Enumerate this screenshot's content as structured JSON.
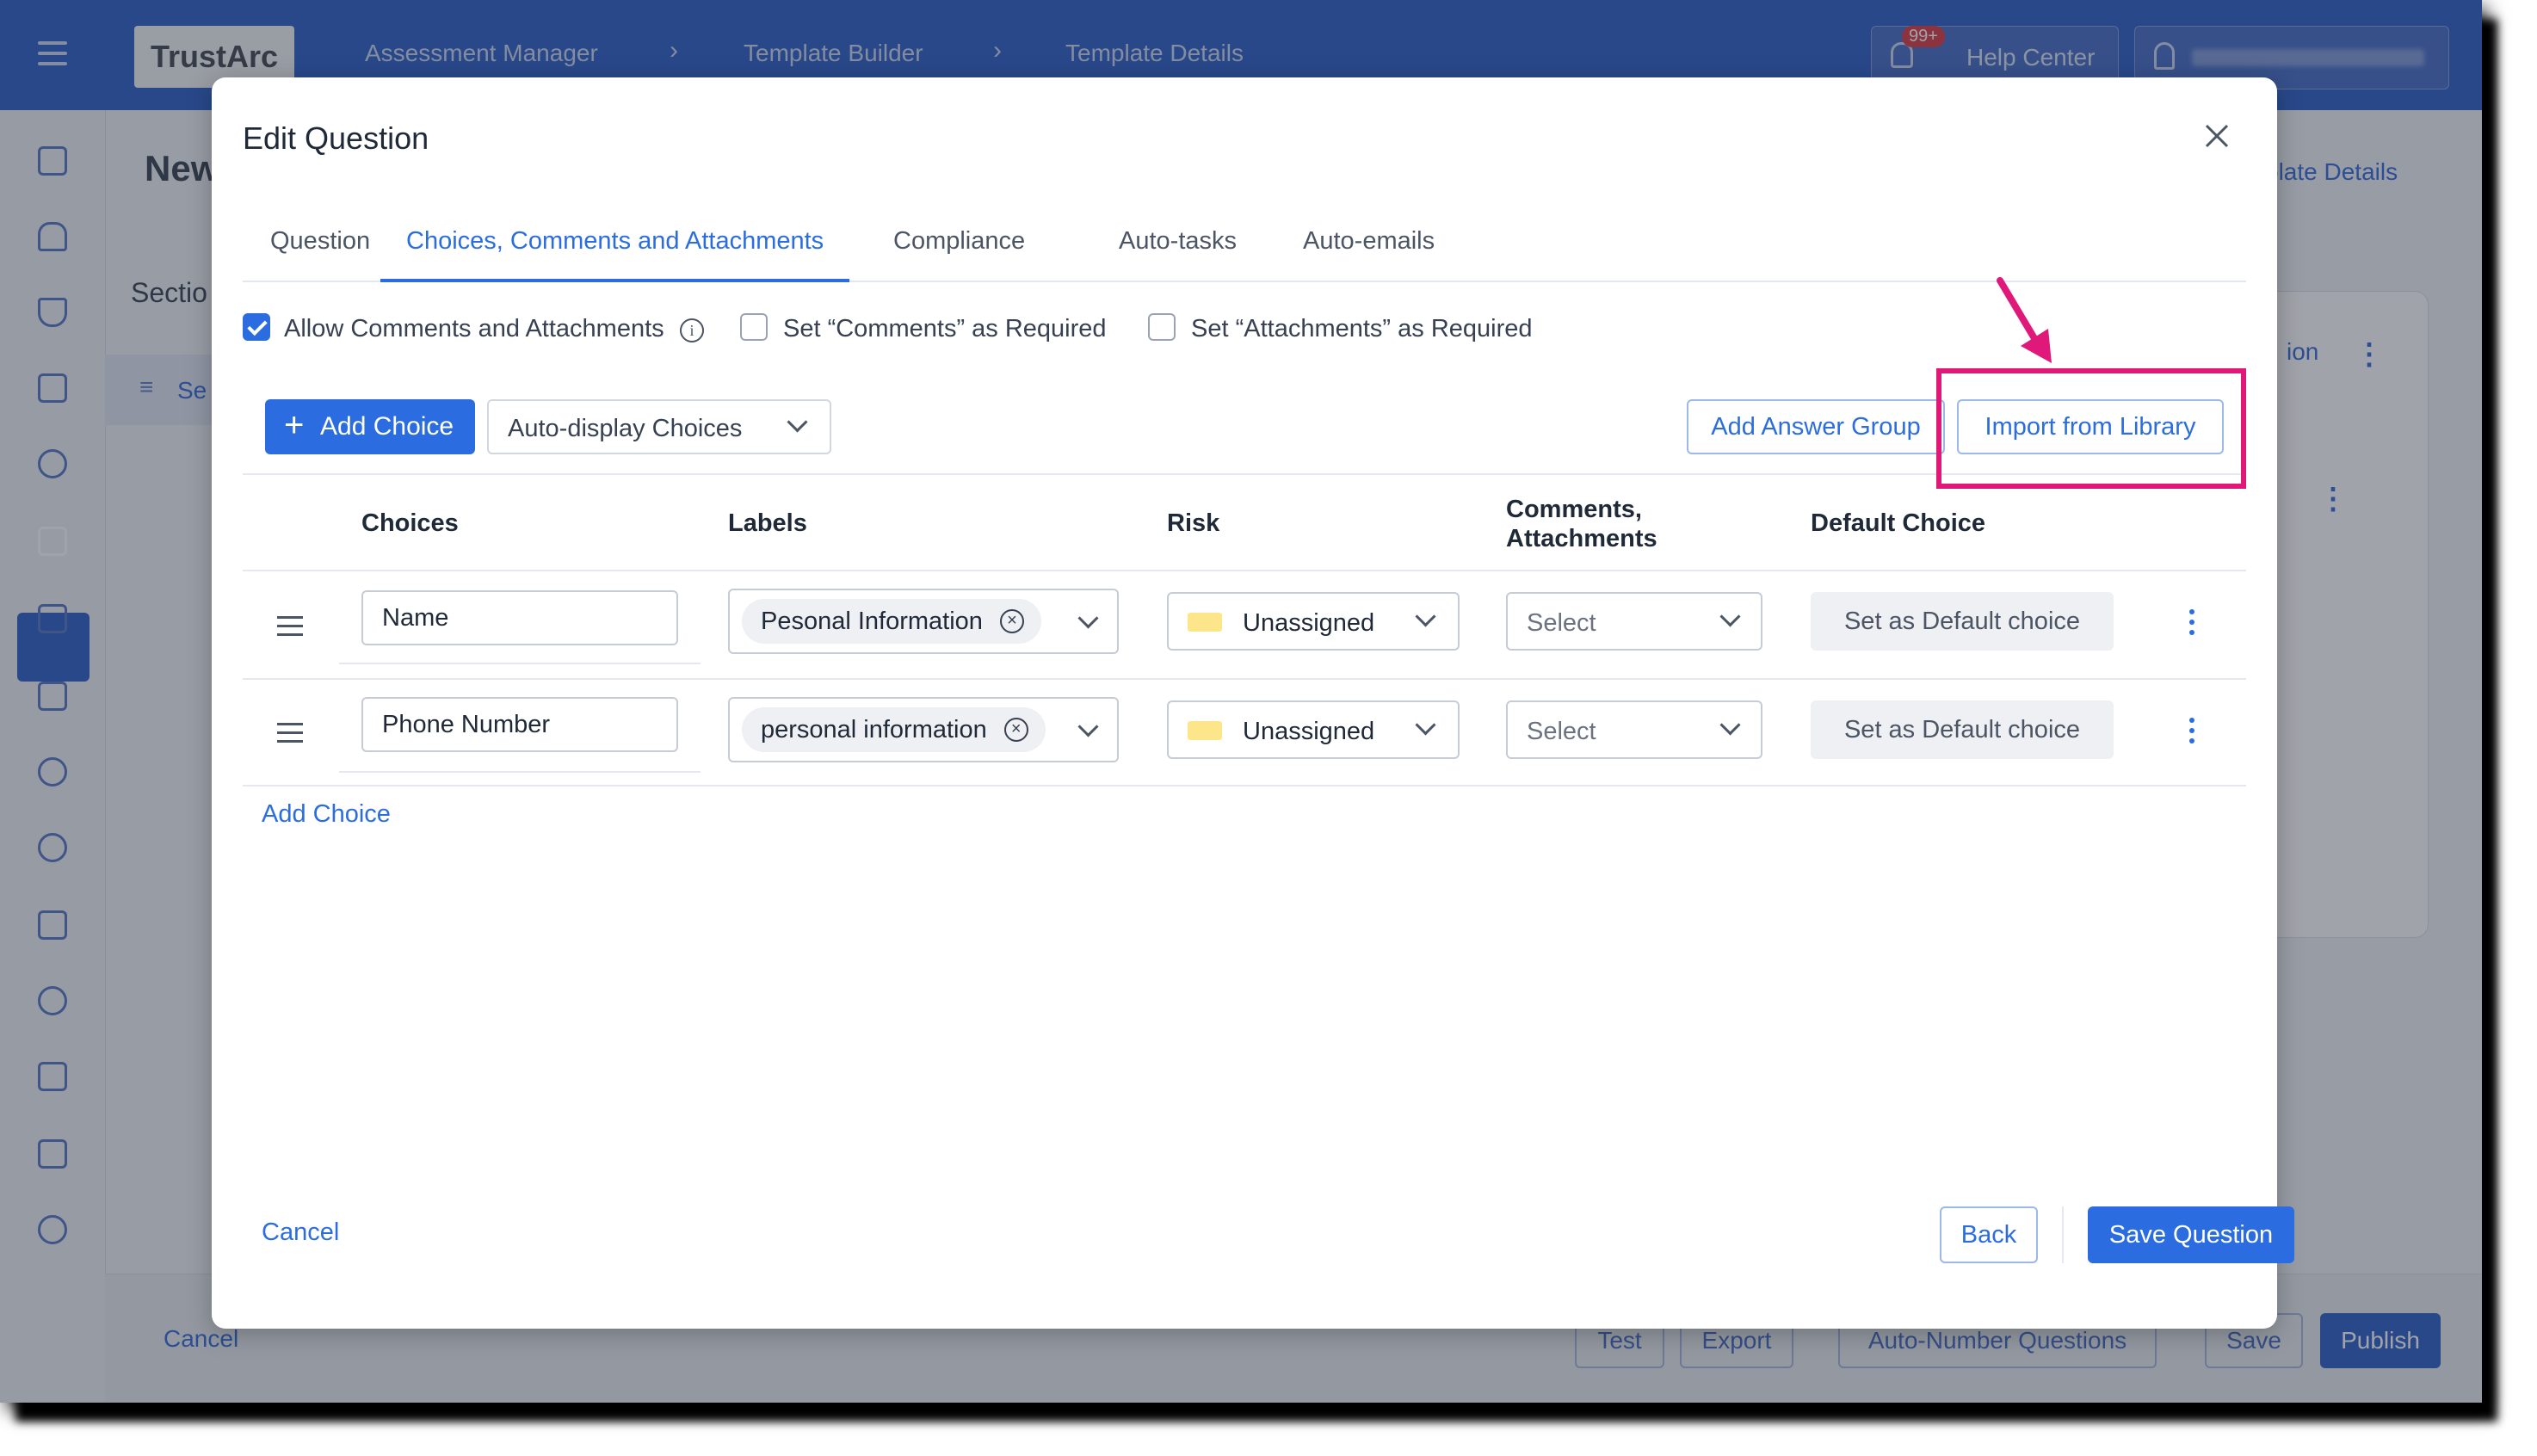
{
  "app": {
    "logo": "TrustArc",
    "breadcrumbs": [
      "Assessment Manager",
      "Template Builder",
      "Template Details"
    ],
    "notification_count": "99+",
    "help_center": "Help Center"
  },
  "background": {
    "page_title_partial": "New",
    "section_partial": "Sectio",
    "section_item_partial": "Se",
    "template_details_link": "plate Details",
    "section_link_partial": "ion",
    "bottom": {
      "cancel": "Cancel",
      "test": "Test",
      "export": "Export",
      "auto_number": "Auto-Number Questions",
      "save": "Save",
      "publish": "Publish"
    }
  },
  "modal": {
    "title": "Edit Question",
    "tabs": [
      "Question",
      "Choices, Comments and Attachments",
      "Compliance",
      "Auto-tasks",
      "Auto-emails"
    ],
    "active_tab": "Choices, Comments and Attachments",
    "options": {
      "allow_comments": "Allow Comments and Attachments",
      "allow_comments_checked": true,
      "comments_required": "Set “Comments” as Required",
      "attachments_required": "Set “Attachments” as Required"
    },
    "toolbar": {
      "add_choice": "Add Choice",
      "auto_display": "Auto-display Choices",
      "add_answer_group": "Add Answer Group",
      "import_from_library": "Import from Library"
    },
    "table": {
      "headers": {
        "choices": "Choices",
        "labels": "Labels",
        "risk": "Risk",
        "comments_line1": "Comments,",
        "comments_line2": "Attachments",
        "default_choice": "Default Choice"
      },
      "rows": [
        {
          "choice": "Name",
          "label": "Pesonal Information",
          "risk": "Unassigned",
          "comments": "Select",
          "default": "Set as Default choice"
        },
        {
          "choice": "Phone Number",
          "label": "personal information",
          "risk": "Unassigned",
          "comments": "Select",
          "default": "Set as Default choice"
        }
      ]
    },
    "add_choice_link": "Add Choice",
    "footer": {
      "cancel": "Cancel",
      "back": "Back",
      "save_question": "Save Question"
    }
  },
  "colors": {
    "primary": "#2b6de0",
    "topbar": "#2458c6",
    "highlight": "#e0187a",
    "risk_unassigned": "#fde68a"
  }
}
